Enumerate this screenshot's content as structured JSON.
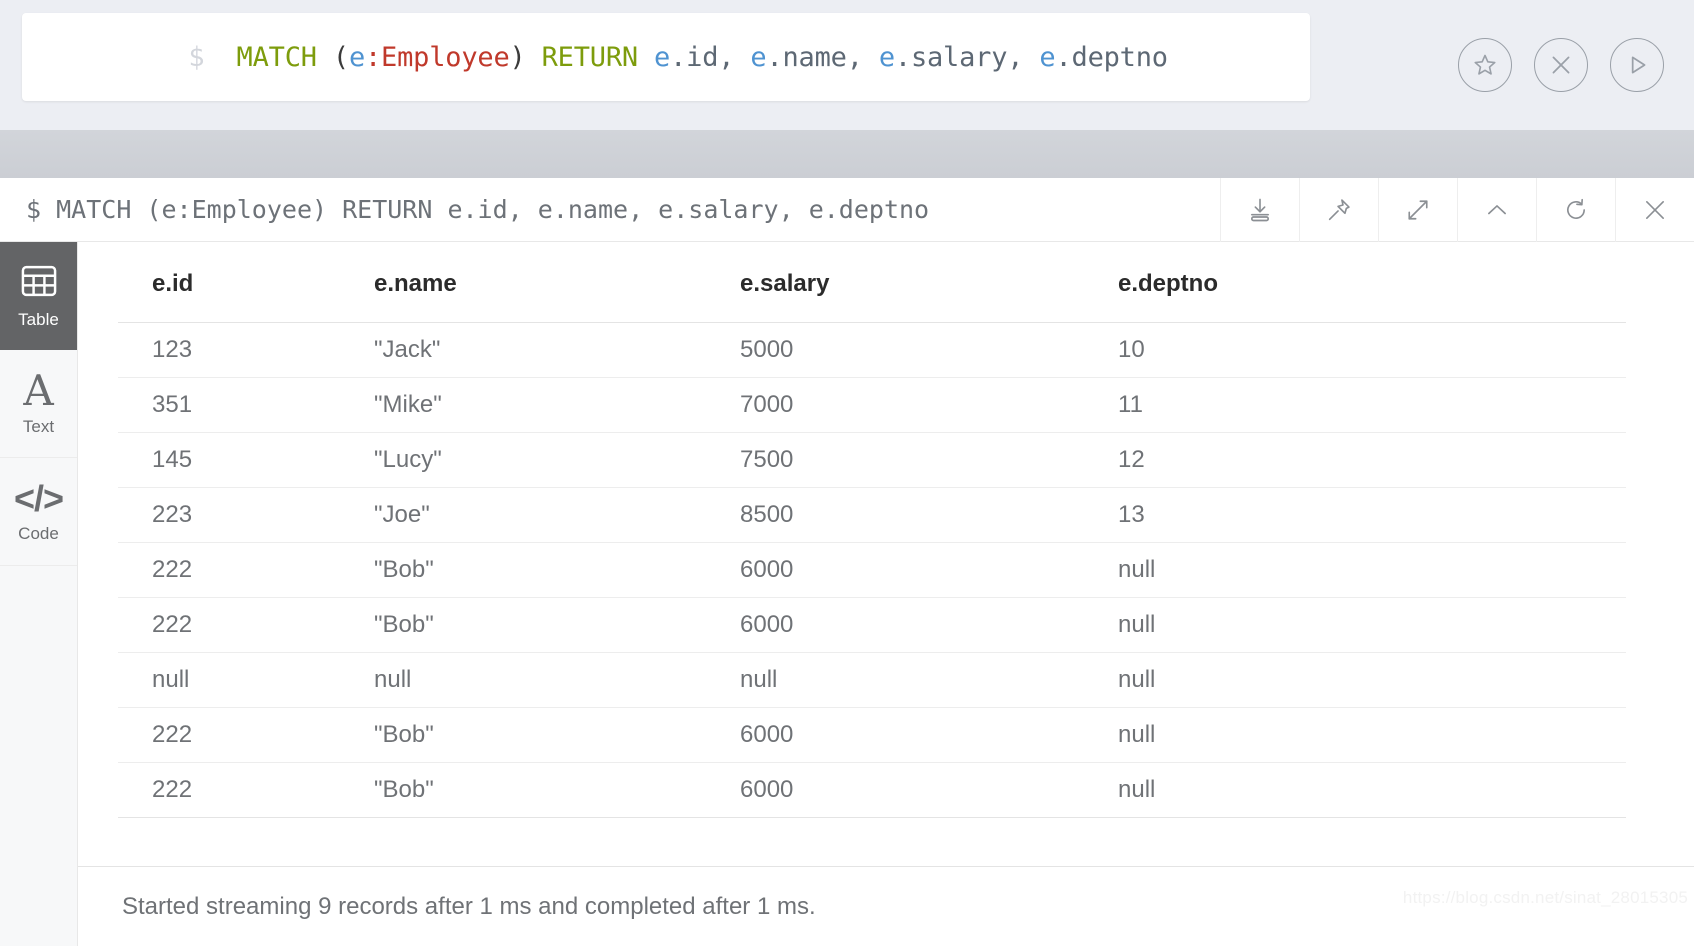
{
  "editor": {
    "prompt": "$",
    "query_tokens": [
      {
        "t": "MATCH",
        "k": "kw"
      },
      {
        "t": " ",
        "k": "plain"
      },
      {
        "t": "(",
        "k": "paren"
      },
      {
        "t": "e",
        "k": "var"
      },
      {
        "t": ":Employee",
        "k": "label"
      },
      {
        "t": ")",
        "k": "paren"
      },
      {
        "t": " ",
        "k": "plain"
      },
      {
        "t": "RETURN",
        "k": "kw"
      },
      {
        "t": " ",
        "k": "plain"
      },
      {
        "t": "e",
        "k": "var"
      },
      {
        "t": ".id, ",
        "k": "plain"
      },
      {
        "t": "e",
        "k": "var"
      },
      {
        "t": ".name, ",
        "k": "plain"
      },
      {
        "t": "e",
        "k": "var"
      },
      {
        "t": ".salary, ",
        "k": "plain"
      },
      {
        "t": "e",
        "k": "var"
      },
      {
        "t": ".deptno",
        "k": "plain"
      }
    ],
    "query_plain": "MATCH (e:Employee) RETURN e.id, e.name, e.salary, e.deptno",
    "actions": [
      {
        "name": "favorite-button",
        "icon": "star-icon"
      },
      {
        "name": "clear-button",
        "icon": "close-circle-icon"
      },
      {
        "name": "run-button",
        "icon": "play-icon"
      }
    ],
    "colors": {
      "keyword": "#7d9c0c",
      "variable": "#4f93d1",
      "label": "#c0392b",
      "plain": "#5d6874",
      "prompt": "#d3d6dc",
      "background": "#eceef3"
    }
  },
  "frame": {
    "prompt": "$",
    "query": "MATCH (e:Employee) RETURN e.id, e.name, e.salary, e.deptno",
    "tools": [
      {
        "name": "download-button",
        "icon": "download-icon"
      },
      {
        "name": "pin-button",
        "icon": "pin-icon"
      },
      {
        "name": "fullscreen-button",
        "icon": "expand-icon"
      },
      {
        "name": "collapse-button",
        "icon": "chevron-up-icon"
      },
      {
        "name": "rerun-button",
        "icon": "refresh-icon"
      },
      {
        "name": "close-button",
        "icon": "close-icon"
      }
    ]
  },
  "sidebar": {
    "items": [
      {
        "label": "Table",
        "icon": "table-grid-icon",
        "active": true
      },
      {
        "label": "Text",
        "icon": "letter-a-icon",
        "active": false
      },
      {
        "label": "Code",
        "icon": "code-brackets-icon",
        "active": false
      }
    ]
  },
  "table": {
    "columns": [
      "e.id",
      "e.name",
      "e.salary",
      "e.deptno"
    ],
    "rows": [
      [
        "123",
        "\"Jack\"",
        "5000",
        "10"
      ],
      [
        "351",
        "\"Mike\"",
        "7000",
        "11"
      ],
      [
        "145",
        "\"Lucy\"",
        "7500",
        "12"
      ],
      [
        "223",
        "\"Joe\"",
        "8500",
        "13"
      ],
      [
        "222",
        "\"Bob\"",
        "6000",
        "null"
      ],
      [
        "222",
        "\"Bob\"",
        "6000",
        "null"
      ],
      [
        "null",
        "null",
        "null",
        "null"
      ],
      [
        "222",
        "\"Bob\"",
        "6000",
        "null"
      ],
      [
        "222",
        "\"Bob\"",
        "6000",
        "null"
      ]
    ]
  },
  "status": {
    "message": "Started streaming 9 records after 1 ms and completed after 1 ms."
  },
  "watermark": {
    "text": "https://blog.csdn.net/sinat_28015305"
  }
}
